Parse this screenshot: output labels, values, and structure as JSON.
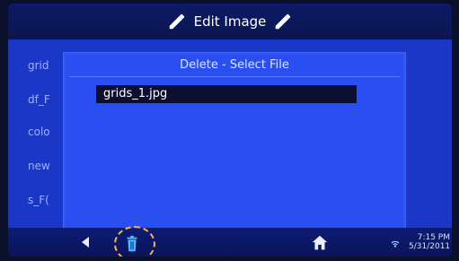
{
  "header": {
    "title": "Edit Image"
  },
  "background_list": {
    "items": [
      "grid",
      "df_F",
      "colo",
      "new",
      "s_F("
    ]
  },
  "dialog": {
    "title": "Delete - Select File",
    "selected_file": "grids_1.jpg"
  },
  "status": {
    "time": "7:15 PM",
    "date": "5/31/2011"
  },
  "icons": {
    "left": "pencil-icon",
    "right": "pencil-icon",
    "back": "back-arrow-icon",
    "trash": "trash-icon",
    "home": "home-icon",
    "wifi": "wifi-icon"
  },
  "colors": {
    "screen_blue": "#1a37c8",
    "dialog_blue": "#2a4ff0",
    "highlight": "#0c1030",
    "annotation": "#f7b34b"
  }
}
